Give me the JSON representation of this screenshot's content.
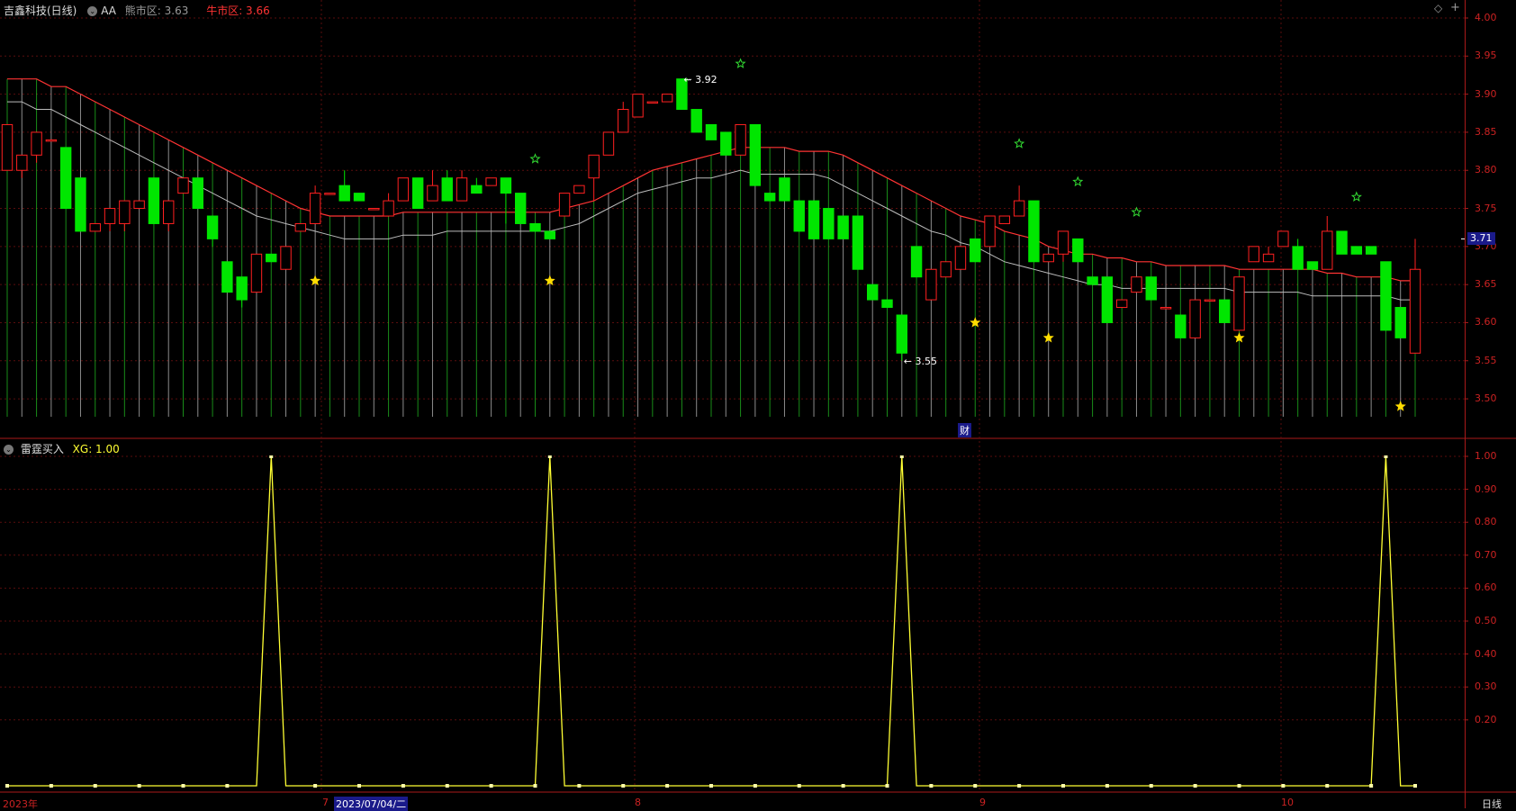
{
  "header": {
    "title": "吉鑫科技(日线)",
    "aa_label": "AA",
    "bear_label": "熊市区: 3.63",
    "bull_label": "牛市区: 3.66"
  },
  "lower_header": {
    "indicator": "雷霆买入",
    "value_label": "XG: 1.00"
  },
  "price_axis_labels": [
    "4.00",
    "3.95",
    "3.90",
    "3.85",
    "3.80",
    "3.75",
    "3.70",
    "3.65",
    "3.60",
    "3.55",
    "3.50"
  ],
  "price_axis_values": [
    4.0,
    3.95,
    3.9,
    3.85,
    3.8,
    3.75,
    3.7,
    3.65,
    3.6,
    3.55,
    3.5
  ],
  "current_price_badge": "3.71",
  "current_price_value": 3.71,
  "indicator_axis_labels": [
    "1.00",
    "0.90",
    "0.80",
    "0.70",
    "0.60",
    "0.50",
    "0.40",
    "0.30",
    "0.20"
  ],
  "indicator_axis_values": [
    1.0,
    0.9,
    0.8,
    0.7,
    0.6,
    0.5,
    0.4,
    0.3,
    0.2
  ],
  "annotations": {
    "high": "3.92",
    "low": "3.55",
    "finance": "财"
  },
  "x_axis": {
    "year": "2023年",
    "m7": "7",
    "cursor_date": "2023/07/04/二",
    "m8": "8",
    "m9": "9",
    "m10": "10",
    "period": "日线"
  },
  "colors": {
    "up": "#ff2020",
    "down": "#00e600",
    "ma_red": "#ff3333",
    "ma_gray": "#bbbbbb",
    "indicator": "#ffff33",
    "axis": "#cc2222",
    "star_yellow": "#ffdd00",
    "star_green": "#33dd33"
  },
  "chart_data": [
    {
      "type": "candlestick",
      "title": "吉鑫科技(日线)",
      "ylim": [
        3.47,
        4.01
      ],
      "candles": [
        [
          3.8,
          3.86,
          3.86,
          3.8
        ],
        [
          3.8,
          3.82,
          3.82,
          3.79
        ],
        [
          3.82,
          3.85,
          3.85,
          3.81
        ],
        [
          3.84,
          3.84,
          3.84,
          3.84
        ],
        [
          3.83,
          3.75,
          3.83,
          3.75
        ],
        [
          3.79,
          3.72,
          3.79,
          3.72
        ],
        [
          3.72,
          3.73,
          3.73,
          3.72
        ],
        [
          3.73,
          3.75,
          3.75,
          3.72
        ],
        [
          3.73,
          3.76,
          3.76,
          3.72
        ],
        [
          3.75,
          3.76,
          3.76,
          3.75
        ],
        [
          3.79,
          3.73,
          3.79,
          3.73
        ],
        [
          3.73,
          3.76,
          3.76,
          3.72
        ],
        [
          3.77,
          3.79,
          3.79,
          3.77
        ],
        [
          3.79,
          3.75,
          3.79,
          3.75
        ],
        [
          3.74,
          3.71,
          3.74,
          3.7
        ],
        [
          3.68,
          3.64,
          3.68,
          3.64
        ],
        [
          3.66,
          3.63,
          3.66,
          3.62
        ],
        [
          3.64,
          3.69,
          3.69,
          3.64
        ],
        [
          3.69,
          3.68,
          3.69,
          3.68
        ],
        [
          3.67,
          3.7,
          3.7,
          3.67
        ],
        [
          3.72,
          3.73,
          3.73,
          3.72
        ],
        [
          3.73,
          3.77,
          3.78,
          3.73
        ],
        [
          3.77,
          3.77,
          3.77,
          3.77
        ],
        [
          3.78,
          3.76,
          3.8,
          3.76
        ],
        [
          3.77,
          3.76,
          3.77,
          3.76
        ],
        [
          3.75,
          3.75,
          3.75,
          3.75
        ],
        [
          3.74,
          3.76,
          3.77,
          3.74
        ],
        [
          3.76,
          3.79,
          3.79,
          3.76
        ],
        [
          3.79,
          3.75,
          3.79,
          3.75
        ],
        [
          3.76,
          3.78,
          3.8,
          3.76
        ],
        [
          3.79,
          3.76,
          3.8,
          3.76
        ],
        [
          3.76,
          3.79,
          3.8,
          3.76
        ],
        [
          3.78,
          3.77,
          3.79,
          3.77
        ],
        [
          3.78,
          3.79,
          3.79,
          3.78
        ],
        [
          3.79,
          3.77,
          3.79,
          3.73
        ],
        [
          3.77,
          3.73,
          3.77,
          3.73
        ],
        [
          3.73,
          3.72,
          3.73,
          3.72
        ],
        [
          3.72,
          3.71,
          3.72,
          3.71
        ],
        [
          3.74,
          3.77,
          3.77,
          3.74
        ],
        [
          3.77,
          3.78,
          3.78,
          3.77
        ],
        [
          3.79,
          3.82,
          3.82,
          3.76
        ],
        [
          3.82,
          3.85,
          3.85,
          3.82
        ],
        [
          3.85,
          3.88,
          3.89,
          3.85
        ],
        [
          3.87,
          3.9,
          3.9,
          3.87
        ],
        [
          3.89,
          3.89,
          3.89,
          3.89
        ],
        [
          3.89,
          3.9,
          3.9,
          3.89
        ],
        [
          3.92,
          3.88,
          3.92,
          3.88
        ],
        [
          3.88,
          3.85,
          3.88,
          3.85
        ],
        [
          3.86,
          3.84,
          3.86,
          3.84
        ],
        [
          3.85,
          3.82,
          3.85,
          3.82
        ],
        [
          3.82,
          3.86,
          3.86,
          3.82
        ],
        [
          3.86,
          3.78,
          3.86,
          3.78
        ],
        [
          3.77,
          3.76,
          3.77,
          3.76
        ],
        [
          3.79,
          3.76,
          3.79,
          3.76
        ],
        [
          3.76,
          3.72,
          3.76,
          3.72
        ],
        [
          3.76,
          3.71,
          3.76,
          3.71
        ],
        [
          3.75,
          3.71,
          3.75,
          3.71
        ],
        [
          3.74,
          3.71,
          3.74,
          3.71
        ],
        [
          3.74,
          3.67,
          3.74,
          3.67
        ],
        [
          3.65,
          3.63,
          3.65,
          3.63
        ],
        [
          3.63,
          3.62,
          3.63,
          3.62
        ],
        [
          3.61,
          3.56,
          3.61,
          3.55
        ],
        [
          3.7,
          3.66,
          3.7,
          3.66
        ],
        [
          3.63,
          3.67,
          3.67,
          3.63
        ],
        [
          3.66,
          3.68,
          3.68,
          3.66
        ],
        [
          3.67,
          3.7,
          3.7,
          3.67
        ],
        [
          3.71,
          3.68,
          3.71,
          3.68
        ],
        [
          3.7,
          3.74,
          3.74,
          3.7
        ],
        [
          3.73,
          3.74,
          3.74,
          3.73
        ],
        [
          3.74,
          3.76,
          3.78,
          3.74
        ],
        [
          3.76,
          3.68,
          3.76,
          3.68
        ],
        [
          3.68,
          3.69,
          3.69,
          3.68
        ],
        [
          3.69,
          3.72,
          3.72,
          3.68
        ],
        [
          3.71,
          3.68,
          3.71,
          3.68
        ],
        [
          3.66,
          3.65,
          3.66,
          3.65
        ],
        [
          3.66,
          3.6,
          3.66,
          3.6
        ],
        [
          3.62,
          3.63,
          3.63,
          3.62
        ],
        [
          3.64,
          3.66,
          3.66,
          3.64
        ],
        [
          3.66,
          3.63,
          3.66,
          3.63
        ],
        [
          3.62,
          3.62,
          3.62,
          3.62
        ],
        [
          3.61,
          3.58,
          3.61,
          3.58
        ],
        [
          3.58,
          3.63,
          3.63,
          3.58
        ],
        [
          3.63,
          3.63,
          3.63,
          3.63
        ],
        [
          3.63,
          3.6,
          3.63,
          3.6
        ],
        [
          3.59,
          3.66,
          3.66,
          3.59
        ],
        [
          3.68,
          3.7,
          3.7,
          3.68
        ],
        [
          3.68,
          3.69,
          3.7,
          3.68
        ],
        [
          3.7,
          3.72,
          3.72,
          3.7
        ],
        [
          3.7,
          3.67,
          3.71,
          3.67
        ],
        [
          3.68,
          3.67,
          3.68,
          3.67
        ],
        [
          3.67,
          3.72,
          3.74,
          3.67
        ],
        [
          3.72,
          3.69,
          3.72,
          3.69
        ],
        [
          3.7,
          3.69,
          3.7,
          3.69
        ],
        [
          3.7,
          3.69,
          3.7,
          3.69
        ],
        [
          3.68,
          3.59,
          3.68,
          3.59
        ],
        [
          3.62,
          3.58,
          3.62,
          3.58
        ],
        [
          3.56,
          3.67,
          3.71,
          3.56
        ]
      ],
      "ma_red": [
        3.92,
        3.92,
        3.92,
        3.91,
        3.91,
        3.9,
        3.89,
        3.88,
        3.87,
        3.86,
        3.85,
        3.84,
        3.83,
        3.82,
        3.81,
        3.8,
        3.79,
        3.78,
        3.77,
        3.76,
        3.75,
        3.745,
        3.74,
        3.74,
        3.74,
        3.74,
        3.74,
        3.745,
        3.745,
        3.745,
        3.745,
        3.745,
        3.745,
        3.745,
        3.745,
        3.745,
        3.745,
        3.745,
        3.75,
        3.755,
        3.76,
        3.77,
        3.78,
        3.79,
        3.8,
        3.805,
        3.81,
        3.815,
        3.82,
        3.825,
        3.83,
        3.83,
        3.83,
        3.83,
        3.825,
        3.825,
        3.825,
        3.82,
        3.81,
        3.8,
        3.79,
        3.78,
        3.77,
        3.76,
        3.75,
        3.74,
        3.735,
        3.73,
        3.72,
        3.715,
        3.71,
        3.7,
        3.695,
        3.69,
        3.69,
        3.685,
        3.685,
        3.68,
        3.68,
        3.675,
        3.675,
        3.675,
        3.675,
        3.675,
        3.67,
        3.67,
        3.67,
        3.67,
        3.67,
        3.67,
        3.665,
        3.665,
        3.66,
        3.66,
        3.66,
        3.655,
        3.655
      ],
      "ma_gray": [
        3.89,
        3.89,
        3.88,
        3.88,
        3.87,
        3.86,
        3.85,
        3.84,
        3.83,
        3.82,
        3.81,
        3.8,
        3.79,
        3.78,
        3.77,
        3.76,
        3.75,
        3.74,
        3.735,
        3.73,
        3.725,
        3.72,
        3.715,
        3.71,
        3.71,
        3.71,
        3.71,
        3.715,
        3.715,
        3.715,
        3.72,
        3.72,
        3.72,
        3.72,
        3.72,
        3.72,
        3.72,
        3.72,
        3.725,
        3.73,
        3.74,
        3.75,
        3.76,
        3.77,
        3.775,
        3.78,
        3.785,
        3.79,
        3.79,
        3.795,
        3.8,
        3.795,
        3.795,
        3.795,
        3.795,
        3.795,
        3.79,
        3.78,
        3.77,
        3.76,
        3.75,
        3.74,
        3.73,
        3.72,
        3.715,
        3.705,
        3.7,
        3.69,
        3.68,
        3.675,
        3.67,
        3.665,
        3.66,
        3.655,
        3.65,
        3.65,
        3.645,
        3.645,
        3.645,
        3.645,
        3.645,
        3.645,
        3.645,
        3.645,
        3.64,
        3.64,
        3.64,
        3.64,
        3.64,
        3.635,
        3.635,
        3.635,
        3.635,
        3.635,
        3.635,
        3.63,
        3.63
      ],
      "stars_yellow": [
        [
          21,
          3.655
        ],
        [
          37,
          3.655
        ],
        [
          66,
          3.6
        ],
        [
          71,
          3.58
        ],
        [
          84,
          3.58
        ],
        [
          95,
          3.49
        ]
      ],
      "stars_green": [
        [
          36,
          3.815
        ],
        [
          50,
          3.94
        ],
        [
          69,
          3.835
        ],
        [
          73,
          3.785
        ],
        [
          77,
          3.745
        ],
        [
          92,
          3.765
        ]
      ],
      "high_marker": [
        46,
        3.92
      ],
      "low_marker": [
        61,
        3.55
      ]
    },
    {
      "type": "line",
      "title": "雷霆买入",
      "ylim": [
        0,
        1.05
      ],
      "pulse_at": [
        18,
        37,
        61,
        94
      ],
      "marker_every": 3
    }
  ]
}
